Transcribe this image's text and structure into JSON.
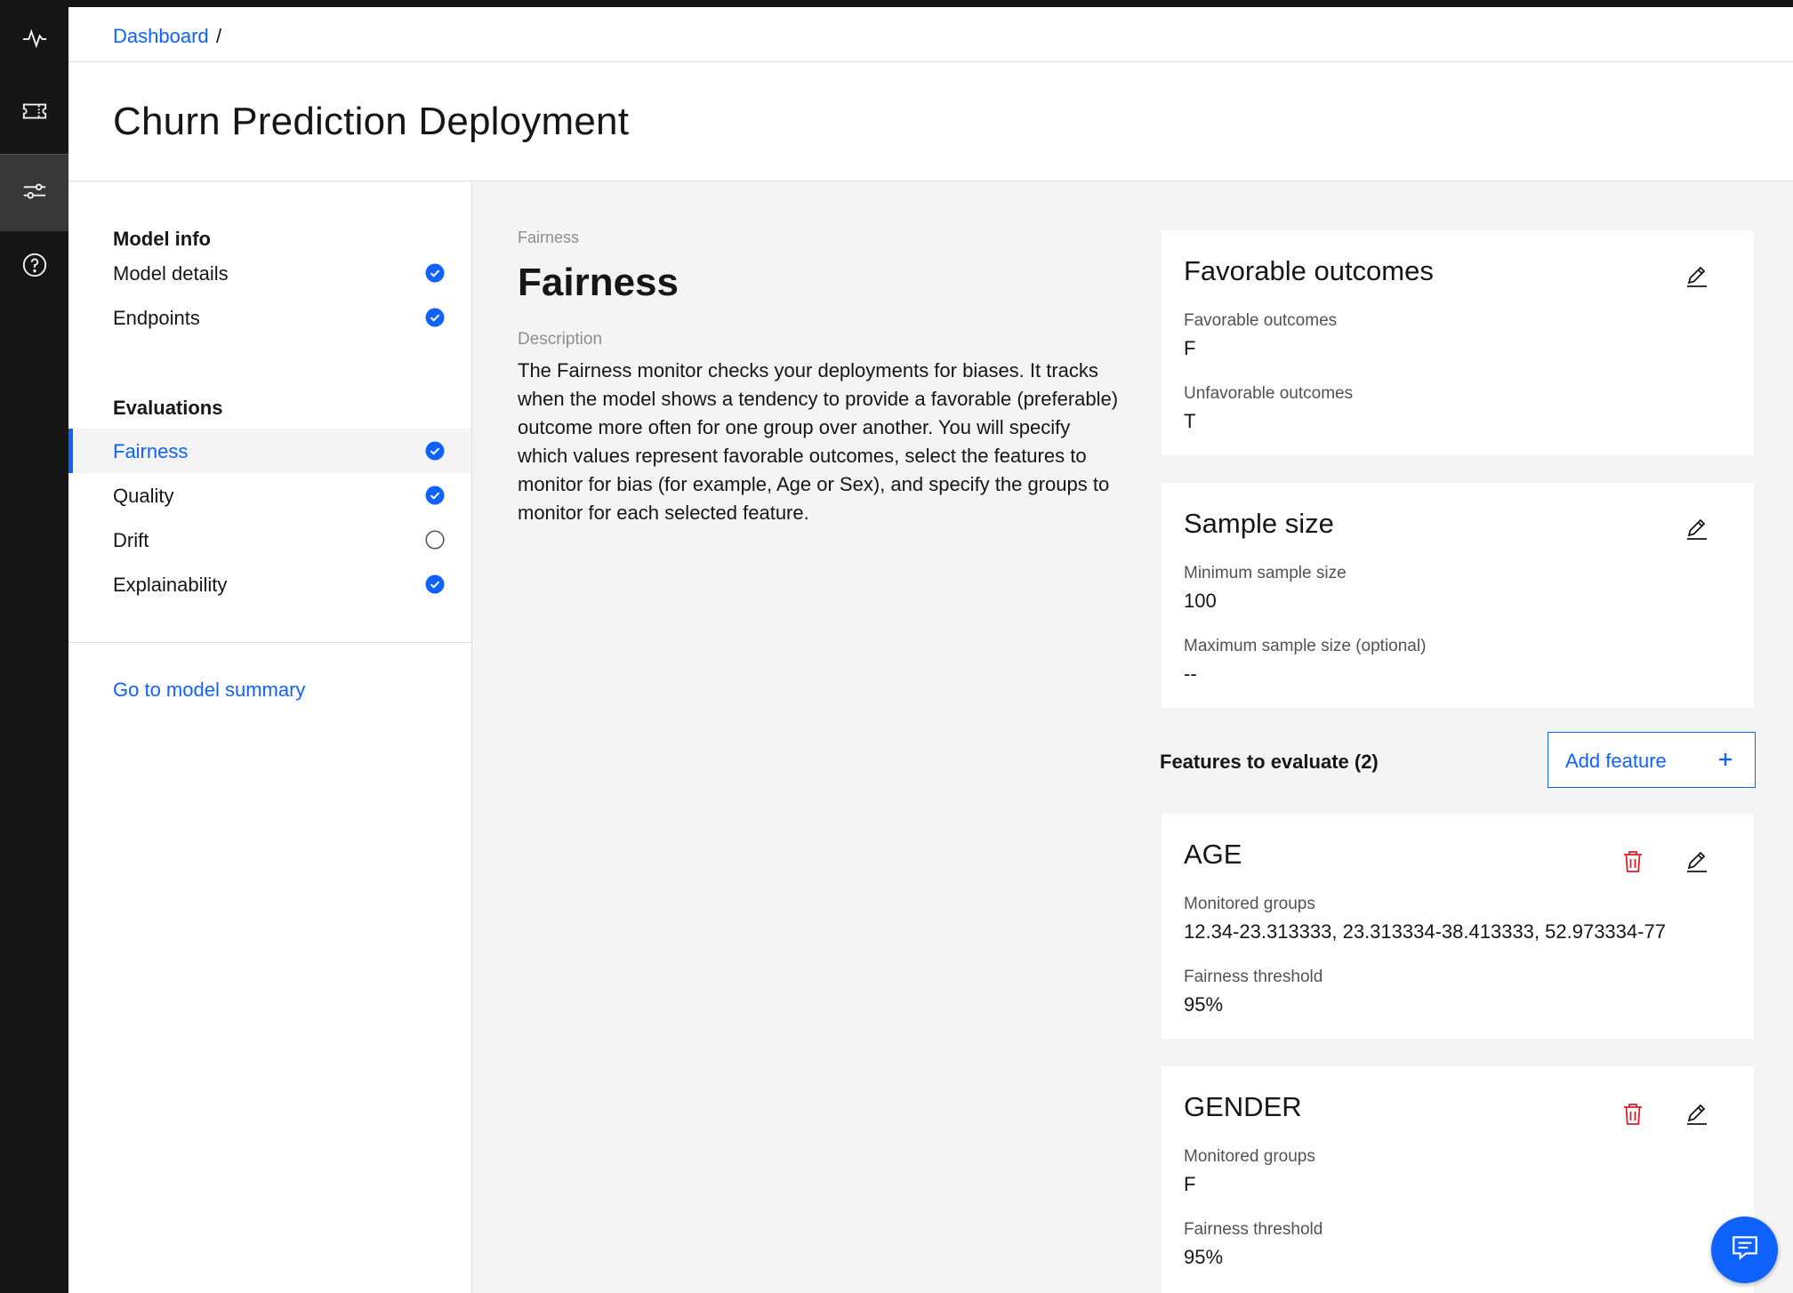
{
  "breadcrumb": {
    "link": "Dashboard",
    "separator": "/"
  },
  "page": {
    "title": "Churn Prediction Deployment"
  },
  "rail": {
    "icons": [
      "activity-icon",
      "ticket-icon",
      "sliders-icon",
      "help-icon"
    ],
    "active": "sliders-icon"
  },
  "sidebar": {
    "groups": [
      {
        "title": "Model info",
        "items": [
          {
            "label": "Model details",
            "status": "complete"
          },
          {
            "label": "Endpoints",
            "status": "complete"
          }
        ]
      },
      {
        "title": "Evaluations",
        "items": [
          {
            "label": "Fairness",
            "status": "complete",
            "active": true
          },
          {
            "label": "Quality",
            "status": "complete"
          },
          {
            "label": "Drift",
            "status": "incomplete"
          },
          {
            "label": "Explainability",
            "status": "complete"
          }
        ]
      }
    ],
    "summary_link": "Go to model summary"
  },
  "main": {
    "eyebrow": "Fairness",
    "title": "Fairness",
    "description_label": "Description",
    "description": "The Fairness monitor checks your deployments for biases. It tracks when the model shows a tendency to provide a favorable (preferable) outcome more often for one group over another. You will specify which values represent favorable outcomes, select the features to monitor for bias (for example, Age or Sex), and specify the groups to monitor for each selected feature."
  },
  "favorable": {
    "title": "Favorable outcomes",
    "fav_label": "Favorable outcomes",
    "fav_value": "F",
    "unfav_label": "Unfavorable outcomes",
    "unfav_value": "T"
  },
  "sample": {
    "title": "Sample size",
    "min_label": "Minimum sample size",
    "min_value": "100",
    "max_label": "Maximum sample size (optional)",
    "max_value": "--"
  },
  "features": {
    "heading": "Features to evaluate (2)",
    "add_label": "Add feature",
    "items": [
      {
        "name": "AGE",
        "groups_label": "Monitored groups",
        "groups": "12.34-23.313333, 23.313334-38.413333, 52.973334-77",
        "threshold_label": "Fairness threshold",
        "threshold": "95%"
      },
      {
        "name": "GENDER",
        "groups_label": "Monitored groups",
        "groups": "F",
        "threshold_label": "Fairness threshold",
        "threshold": "95%"
      }
    ]
  },
  "colors": {
    "accent": "#0f62fe",
    "danger": "#da1e28",
    "rail": "#161616"
  }
}
